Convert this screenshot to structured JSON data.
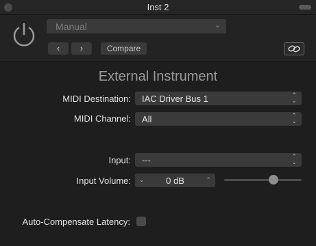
{
  "window": {
    "title": "Inst 2"
  },
  "header": {
    "preset_value": "Manual",
    "prev_label": "‹",
    "next_label": "›",
    "compare_label": "Compare"
  },
  "plugin": {
    "name": "External Instrument"
  },
  "fields": {
    "midi_destination": {
      "label": "MIDI Destination:",
      "value": "IAC Driver Bus 1"
    },
    "midi_channel": {
      "label": "MIDI Channel:",
      "value": "All"
    },
    "input": {
      "label": "Input:",
      "value": "---"
    },
    "input_volume": {
      "label": "Input Volume:",
      "value": "0 dB"
    },
    "auto_compensate": {
      "label": "Auto-Compensate Latency:",
      "checked": false
    }
  },
  "icons": {
    "power": "power-icon",
    "link": "link-icon",
    "close": "close-icon",
    "chevron_down": "chevron-down-icon",
    "up_down": "up-down-arrows-icon"
  },
  "colors": {
    "background": "#1e1e1e",
    "header": "#232323",
    "control": "#3a3a3a",
    "text": "#e2e2e2"
  }
}
